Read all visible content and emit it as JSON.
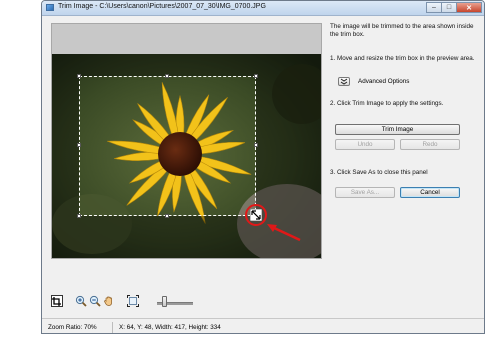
{
  "window": {
    "title": "Trim Image - C:\\Users\\canon\\Pictures\\2007_07_30\\IMG_0700.JPG",
    "minimize": "–",
    "maximize": "□",
    "close": "✕"
  },
  "panel": {
    "intro": "The image will be trimmed to the area shown inside the trim box.",
    "step1": "1.  Move and resize the trim box in the preview area.",
    "advanced_label": "Advanced Options",
    "advanced_icon": "double-chevron-down-icon",
    "step2": "2. Click Trim Image to apply the settings.",
    "trim_button": "Trim Image",
    "undo_button": "Undo",
    "redo_button": "Redo",
    "step3": "3. Click Save As to close this panel",
    "save_as_button": "Save As...",
    "cancel_button": "Cancel"
  },
  "toolbar": {
    "tools": [
      "trim-box-tool-icon",
      "zoom-in-icon",
      "zoom-out-icon",
      "hand-pan-icon",
      "fit-to-window-icon"
    ],
    "zoom_slider_level": 0.2
  },
  "status": {
    "zoom": "Zoom Ratio: 70%",
    "coords": "X: 64, Y: 48, Width: 417, Height: 334"
  },
  "colors": {
    "petal": "#f2c21a",
    "center": "#4a1c0a",
    "annotation": "#e01818",
    "titlebar": "#c8daf0"
  }
}
